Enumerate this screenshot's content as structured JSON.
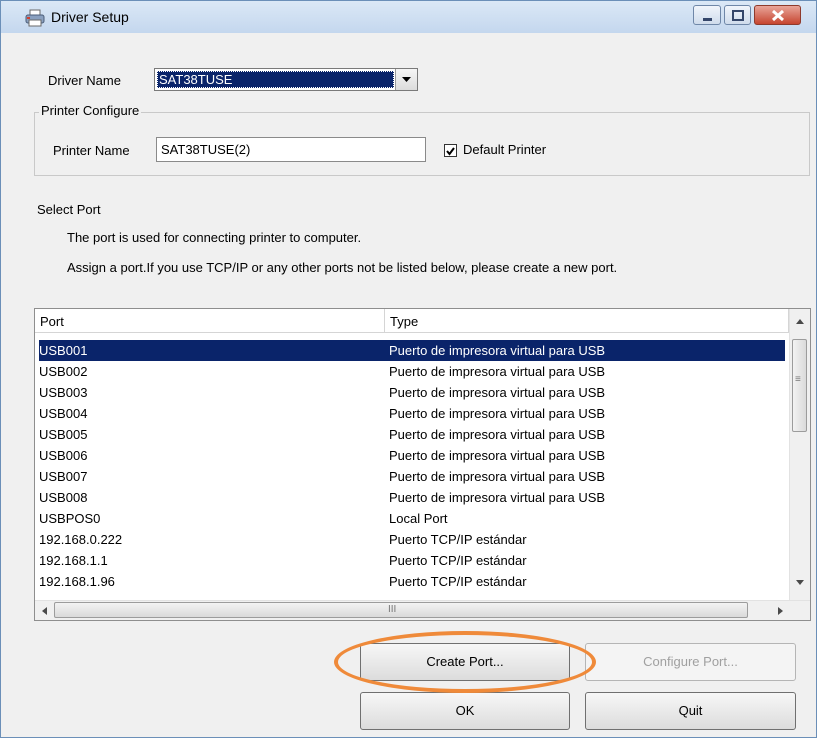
{
  "window": {
    "title": "Driver Setup",
    "icon": "printer-icon",
    "controls": [
      "minimize-icon",
      "maximize-icon",
      "close-icon"
    ]
  },
  "driver": {
    "label": "Driver Name",
    "selected": "SAT38TUSE"
  },
  "printer_configure": {
    "group_title": "Printer Configure",
    "name_label": "Printer Name",
    "name_value": "SAT38TUSE(2)",
    "default_label": "Default Printer",
    "default_checked": true
  },
  "select_port": {
    "title": "Select Port",
    "desc1": "The port is used for connecting printer to computer.",
    "desc2": "Assign a port.If you use TCP/IP or any other ports not be listed below, please create a new port."
  },
  "port_list": {
    "headers": [
      "Port",
      "Type"
    ],
    "rows": [
      {
        "port": "USB001",
        "type": "Puerto de impresora virtual para USB",
        "selected": true
      },
      {
        "port": "USB002",
        "type": "Puerto de impresora virtual para USB"
      },
      {
        "port": "USB003",
        "type": "Puerto de impresora virtual para USB"
      },
      {
        "port": "USB004",
        "type": "Puerto de impresora virtual para USB"
      },
      {
        "port": "USB005",
        "type": "Puerto de impresora virtual para USB"
      },
      {
        "port": "USB006",
        "type": "Puerto de impresora virtual para USB"
      },
      {
        "port": "USB007",
        "type": "Puerto de impresora virtual para USB"
      },
      {
        "port": "USB008",
        "type": "Puerto de impresora virtual para USB"
      },
      {
        "port": "USBPOS0",
        "type": "Local Port"
      },
      {
        "port": "192.168.0.222",
        "type": "Puerto TCP/IP estándar"
      },
      {
        "port": "192.168.1.1",
        "type": "Puerto TCP/IP estándar"
      },
      {
        "port": "192.168.1.96",
        "type": "Puerto TCP/IP estándar"
      }
    ],
    "hscroll_grip": "III",
    "vscroll_grip": "≡"
  },
  "buttons": {
    "create_port": "Create Port...",
    "configure_port": "Configure Port...",
    "ok": "OK",
    "quit": "Quit"
  },
  "colors": {
    "selection": "#0a246a",
    "annotation_ring": "#ef8a3a"
  }
}
